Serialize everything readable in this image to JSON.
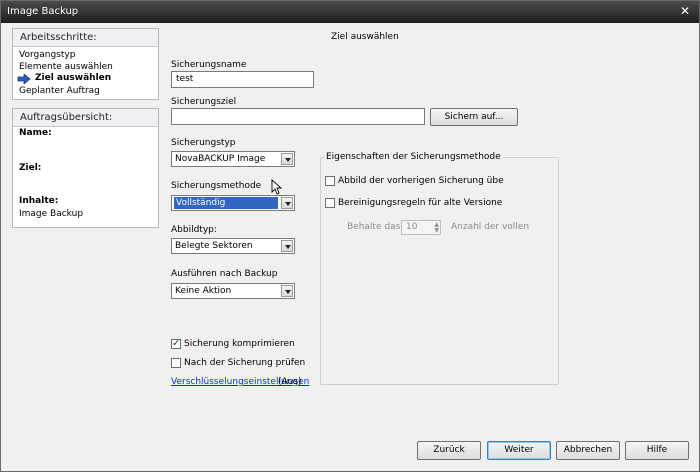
{
  "window": {
    "title": "Image Backup",
    "close_glyph": "✕"
  },
  "steps": {
    "header": "Arbeitsschritte:",
    "items": [
      "Vorgangstyp",
      "Elemente auswählen",
      "Ziel auswählen",
      "Geplanter Auftrag"
    ],
    "active_index": 2
  },
  "summary": {
    "header": "Auftragsübersicht:",
    "name_label": "Name:",
    "ziel_label": "Ziel:",
    "inhalte_label": "Inhalte:",
    "inhalte_value": "Image Backup"
  },
  "main": {
    "heading": "Ziel auswählen",
    "name_label": "Sicherungsname",
    "name_value": "test",
    "target_label": "Sicherungsziel",
    "target_value": "",
    "backup_to_button": "Sichern auf...",
    "type_label": "Sicherungstyp",
    "type_value": "NovaBACKUP Image",
    "method_label": "Sicherungsmethode",
    "method_value": "Vollständig",
    "image_type_label": "Abbildtyp:",
    "image_type_value": "Belegte Sektoren",
    "after_label": "Ausführen nach Backup",
    "after_value": "Keine Aktion",
    "compress_label": "Sicherung komprimieren",
    "compress_checked": true,
    "verify_label": "Nach der Sicherung prüfen",
    "verify_checked": false,
    "encryption_link": "Verschlüsselungseinstellungen",
    "encryption_status": "(Aus)"
  },
  "method_props": {
    "title": "Eigenschaften der Sicherungsmethode",
    "opt1_label": "Abbild der vorherigen Sicherung übe",
    "opt2_label": "Bereinigungsregeln für alte Versione",
    "keep_label": "Behalte das",
    "keep_value": "10",
    "keep_suffix": "Anzahl der vollen"
  },
  "footer": {
    "back": "Zurück",
    "next": "Weiter",
    "cancel": "Abbrechen",
    "help": "Hilfe"
  },
  "colors": {
    "selection": "#3166c1",
    "link": "#0033cc"
  }
}
